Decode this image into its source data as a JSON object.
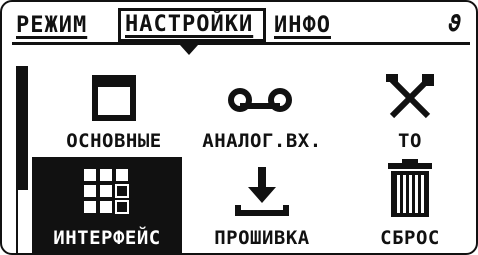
{
  "tabs": [
    {
      "label": "РЕЖИМ"
    },
    {
      "label": "НАСТРОЙКИ"
    },
    {
      "label": "ИНФО"
    }
  ],
  "extra_icon": "ϑ",
  "menu": [
    {
      "label": "ОСНОВНЫЕ",
      "icon": "window-icon"
    },
    {
      "label": "АНАЛОГ.ВХ.",
      "icon": "tape-icon"
    },
    {
      "label": "ТО",
      "icon": "tools-icon"
    },
    {
      "label": "ИНТЕРФЕЙС",
      "icon": "grid-icon",
      "selected": true
    },
    {
      "label": "ПРОШИВКА",
      "icon": "download-icon"
    },
    {
      "label": "СБРОС",
      "icon": "trash-icon"
    }
  ]
}
